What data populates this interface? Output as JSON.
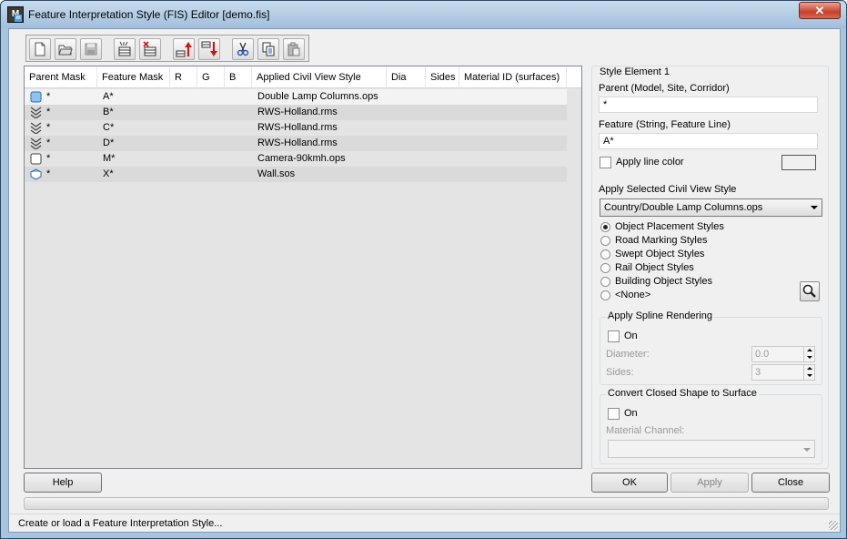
{
  "window": {
    "title": "Feature Interpretation Style (FIS) Editor [demo.fis]",
    "close_glyph": "✕",
    "icon_letter": "M"
  },
  "toolbar": {
    "buttons": [
      {
        "name": "new-icon"
      },
      {
        "name": "open-icon"
      },
      {
        "name": "save-icon"
      },
      {
        "name": "add-row-icon"
      },
      {
        "name": "delete-row-icon"
      },
      {
        "name": "move-up-icon"
      },
      {
        "name": "move-down-icon"
      },
      {
        "name": "cut-icon"
      },
      {
        "name": "copy-icon"
      },
      {
        "name": "paste-icon"
      }
    ]
  },
  "table": {
    "columns": [
      "Parent Mask",
      "Feature Mask",
      "R",
      "G",
      "B",
      "Applied Civil View Style",
      "Dia",
      "Sides",
      "Material ID (surfaces)"
    ],
    "rows": [
      {
        "icon": "placement-icon",
        "parent": "*",
        "feature": "A*",
        "style": "Double Lamp Columns.ops"
      },
      {
        "icon": "marking-icon",
        "parent": "*",
        "feature": "B*",
        "style": "RWS-Holland.rms"
      },
      {
        "icon": "marking-icon",
        "parent": "*",
        "feature": "C*",
        "style": "RWS-Holland.rms"
      },
      {
        "icon": "marking-icon",
        "parent": "*",
        "feature": "D*",
        "style": "RWS-Holland.rms"
      },
      {
        "icon": "shape-icon",
        "parent": "*",
        "feature": "M*",
        "style": "Camera-90kmh.ops"
      },
      {
        "icon": "building-icon",
        "parent": "*",
        "feature": "X*",
        "style": "Wall.sos"
      }
    ]
  },
  "panel": {
    "title": "Style Element 1",
    "parent_label": "Parent (Model, Site, Corridor)",
    "parent_value": "*",
    "feature_label": "Feature (String, Feature Line)",
    "feature_value": "A*",
    "apply_line_color": "Apply line color",
    "line_color": "#f0f0f0",
    "apply_style_label": "Apply Selected Civil View Style",
    "style_value": "Country/Double Lamp Columns.ops",
    "style_types": [
      "Object Placement Styles",
      "Road Marking Styles",
      "Swept Object Styles",
      "Rail Object Styles",
      "Building Object Styles",
      "<None>"
    ],
    "spline": {
      "title": "Apply Spline Rendering",
      "on": "On",
      "diameter_label": "Diameter:",
      "diameter_value": "0.0",
      "sides_label": "Sides:",
      "sides_value": "3"
    },
    "convert": {
      "title": "Convert Closed Shape to Surface",
      "on": "On",
      "channel_label": "Material Channel:"
    }
  },
  "buttons": {
    "help": "Help",
    "ok": "OK",
    "apply": "Apply",
    "close": "Close"
  },
  "status": "Create or load a Feature Interpretation Style..."
}
